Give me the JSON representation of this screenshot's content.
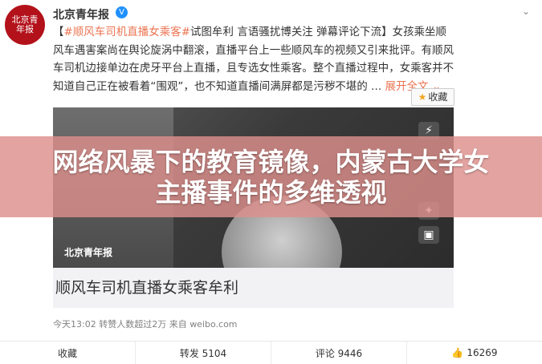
{
  "account": {
    "name": "北京青年报",
    "avatar_text": "北京青年报",
    "verified_badge": "V"
  },
  "post": {
    "topic": "#顺风车司机直播女乘客#",
    "text": "试图牟利 言语骚扰博关注 弹幕评论下流】女孩乘坐顺风车遇害案尚在舆论旋涡中翻滚，直播平台上一些顺风车的视频又引来批评。有顺风车司机边接单边在虎牙平台上直播，且专选女性乘客。整个直播过程中，女乘客并不知道自己正在被看着“围观”，也不知道直播间满屏都是污秽不堪的 ...",
    "open_bracket": "【",
    "expand_label": "展开全文",
    "expand_icon": "chevron-down-icon"
  },
  "favorite_button": {
    "icon": "star-icon",
    "label": "收藏"
  },
  "video": {
    "watermark": "北京青年报",
    "caption": "顺风车司机直播女乘客牟利",
    "controls": [
      "⚡",
      "✦",
      "▣"
    ]
  },
  "meta": {
    "text": "今天13:02 转赞人数超过2万 来自 weibo.com"
  },
  "actions": {
    "favorite": "收藏",
    "repost": "转发 5104",
    "comment": "评论 9446",
    "like_icon": "thumbs-up-icon",
    "like": "16269"
  },
  "overlay": {
    "headline_line1": "网络风暴下的教育镜像，内蒙古大学女",
    "headline_line2": "主播事件的多维透视"
  }
}
